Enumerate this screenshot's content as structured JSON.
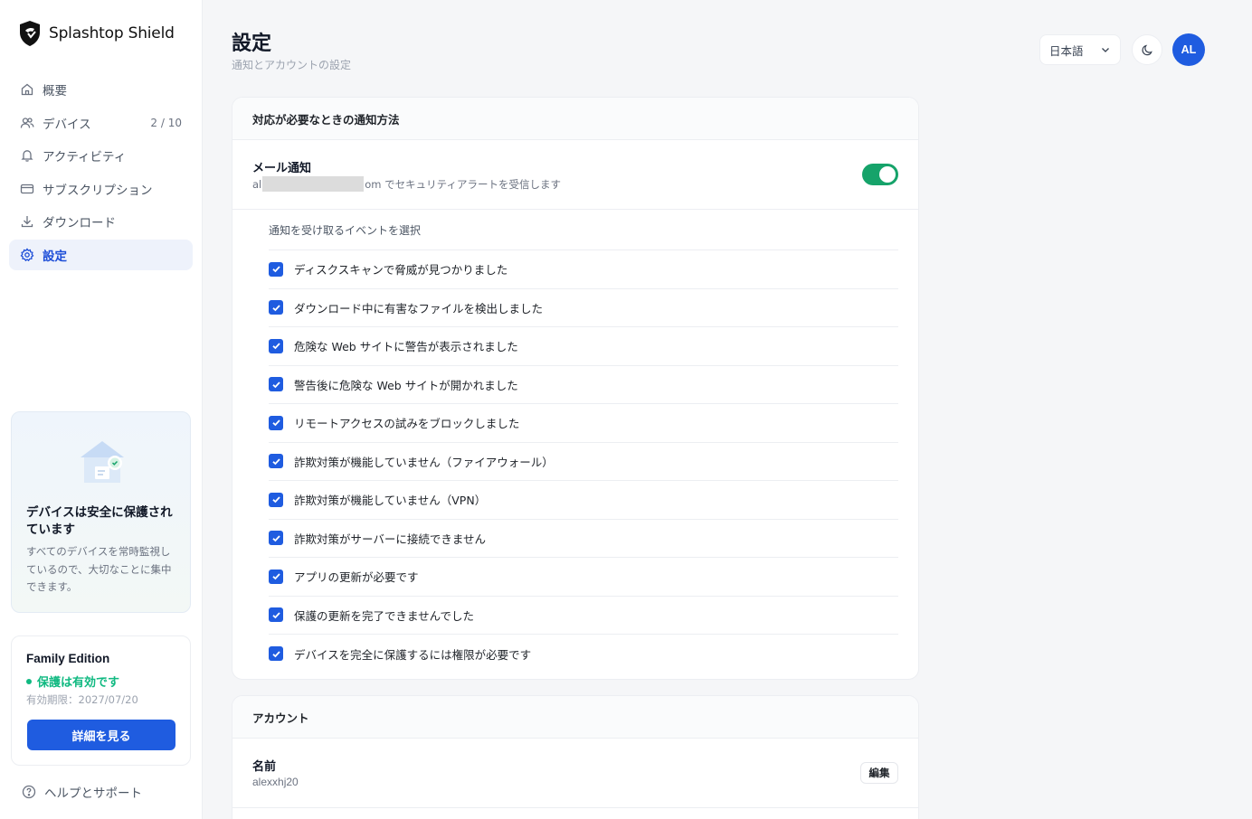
{
  "brand": {
    "name": "Splashtop Shield",
    "logo_icon": "shield-logo-icon"
  },
  "sidebar": {
    "items": [
      {
        "label": "概要",
        "icon": "home-icon",
        "count": ""
      },
      {
        "label": "デバイス",
        "icon": "users-icon",
        "count": "2 / 10"
      },
      {
        "label": "アクティビティ",
        "icon": "bell-icon",
        "count": ""
      },
      {
        "label": "サブスクリプション",
        "icon": "credit-card-icon",
        "count": ""
      },
      {
        "label": "ダウンロード",
        "icon": "download-icon",
        "count": ""
      },
      {
        "label": "設定",
        "icon": "gear-icon",
        "count": ""
      }
    ],
    "active_index": 5
  },
  "safe_card": {
    "title": "デバイスは安全に保護されています",
    "description": "すべてのデバイスを常時監視しているので、大切なことに集中できます。"
  },
  "plan_card": {
    "name": "Family Edition",
    "status": "保護は有効です",
    "expiry": "有効期限：2027/07/20",
    "button_label": "詳細を見る"
  },
  "help": {
    "label": "ヘルプとサポート"
  },
  "header": {
    "title": "設定",
    "subtitle": "通知とアカウントの設定",
    "language": "日本語",
    "avatar_initials": "AL"
  },
  "notifications": {
    "section_title": "対応が必要なときの通知方法",
    "email": {
      "title": "メール通知",
      "desc_prefix": "al",
      "desc_suffix": "om でセキュリティアラートを受信します",
      "enabled": true
    },
    "events_label": "通知を受け取るイベントを選択",
    "events": [
      {
        "label": "ディスクスキャンで脅威が見つかりました",
        "checked": true
      },
      {
        "label": "ダウンロード中に有害なファイルを検出しました",
        "checked": true
      },
      {
        "label": "危険な Web サイトに警告が表示されました",
        "checked": true
      },
      {
        "label": "警告後に危険な Web サイトが開かれました",
        "checked": true
      },
      {
        "label": "リモートアクセスの試みをブロックしました",
        "checked": true
      },
      {
        "label": "詐欺対策が機能していません（ファイアウォール）",
        "checked": true
      },
      {
        "label": "詐欺対策が機能していません（VPN）",
        "checked": true
      },
      {
        "label": "詐欺対策がサーバーに接続できません",
        "checked": true
      },
      {
        "label": "アプリの更新が必要です",
        "checked": true
      },
      {
        "label": "保護の更新を完了できませんでした",
        "checked": true
      },
      {
        "label": "デバイスを完全に保護するには権限が必要です",
        "checked": true
      }
    ]
  },
  "account": {
    "section_title": "アカウント",
    "name_label": "名前",
    "name_value": "alexxhj20",
    "edit_label": "編集"
  },
  "colors": {
    "accent": "#1f5ce0",
    "toggle_on": "#16a36a",
    "status_green": "#10b981"
  }
}
